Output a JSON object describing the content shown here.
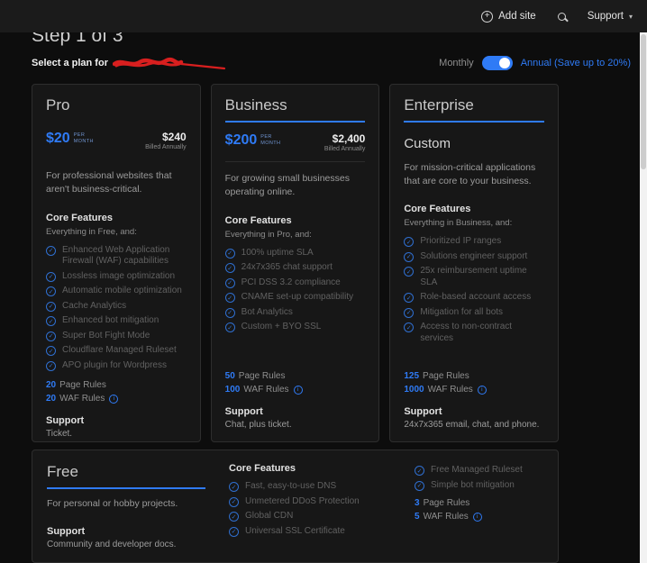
{
  "icons": {
    "add": "+",
    "caret": "▾",
    "check": "✓",
    "info": "i"
  },
  "header": {
    "add_site_label": "Add site",
    "support_label": "Support"
  },
  "page": {
    "step_title": "Step 1 of 3",
    "select_label": "Select a plan for",
    "billing": {
      "monthly": "Monthly",
      "annual": "Annual (Save up to 20%)"
    }
  },
  "plans": [
    {
      "name": "Pro",
      "price": "$20",
      "per_line1": "PER",
      "per_line2": "MONTH",
      "billed_amount": "$240",
      "billed_note": "Billed Annually",
      "description": "For professional websites that aren't business-critical.",
      "core_features_title": "Core Features",
      "core_features_sub": "Everything in Free, and:",
      "features": [
        "Enhanced Web Application Firewall (WAF) capabilities",
        "Lossless image optimization",
        "Automatic mobile optimization",
        "Cache Analytics",
        "Enhanced bot mitigation",
        "Super Bot Fight Mode",
        "Cloudflare Managed Ruleset",
        "APO plugin for Wordpress"
      ],
      "page_rules_value": "20",
      "page_rules_label": "Page Rules",
      "waf_rules_value": "20",
      "waf_rules_label": "WAF Rules",
      "support_title": "Support",
      "support_text": "Ticket."
    },
    {
      "name": "Business",
      "price": "$200",
      "per_line1": "PER",
      "per_line2": "MONTH",
      "billed_amount": "$2,400",
      "billed_note": "Billed Annually",
      "description": "For growing small businesses operating online.",
      "core_features_title": "Core Features",
      "core_features_sub": "Everything in Pro, and:",
      "features": [
        "100% uptime SLA",
        "24x7x365 chat support",
        "PCI DSS 3.2 compliance",
        "CNAME set-up compatibility",
        "Bot Analytics",
        "Custom + BYO SSL"
      ],
      "page_rules_value": "50",
      "page_rules_label": "Page Rules",
      "waf_rules_value": "100",
      "waf_rules_label": "WAF Rules",
      "support_title": "Support",
      "support_text": "Chat, plus ticket."
    },
    {
      "name": "Enterprise",
      "price_label": "Custom",
      "description": "For mission-critical applications that are core to your business.",
      "core_features_title": "Core Features",
      "core_features_sub": "Everything in Business, and:",
      "features": [
        "Prioritized IP ranges",
        "Solutions engineer support",
        "25x reimbursement uptime SLA",
        "Role-based account access",
        "Mitigation for all bots",
        "Access to non-contract services"
      ],
      "page_rules_value": "125",
      "page_rules_label": "Page Rules",
      "waf_rules_value": "1000",
      "waf_rules_label": "WAF Rules",
      "support_title": "Support",
      "support_text": "24x7x365 email, chat, and phone."
    }
  ],
  "free_plan": {
    "name": "Free",
    "description": "For personal or hobby projects.",
    "support_title": "Support",
    "support_text": "Community and developer docs.",
    "core_features_title": "Core Features",
    "features_left": [
      "Fast, easy-to-use DNS",
      "Unmetered DDoS Protection",
      "Global CDN",
      "Universal SSL Certificate"
    ],
    "features_right": [
      "Free Managed Ruleset",
      "Simple bot mitigation"
    ],
    "page_rules_value": "3",
    "page_rules_label": "Page Rules",
    "waf_rules_value": "5",
    "waf_rules_label": "WAF Rules"
  },
  "colors": {
    "accent_blue": "#2f7bf6",
    "redaction_red": "#d81f1f",
    "card_background": "#171717",
    "page_background": "#0d0d0d"
  }
}
